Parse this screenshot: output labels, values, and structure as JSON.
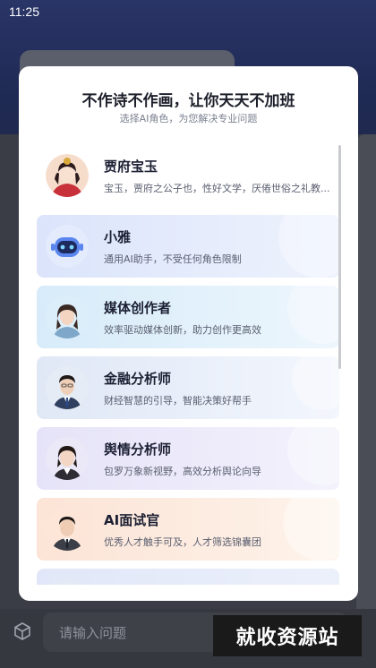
{
  "status_bar": {
    "time": "11:25"
  },
  "modal": {
    "title": "不作诗不作画，让你天天不加班",
    "subtitle": "选择AI角色，为您解决专业问题",
    "roles": [
      {
        "name": "贾府宝玉",
        "desc": "宝玉，贾府之公子也，性好文学，厌倦世俗之礼教..."
      },
      {
        "name": "小雅",
        "desc": "通用AI助手，不受任何角色限制"
      },
      {
        "name": "媒体创作者",
        "desc": "效率驱动媒体创新，助力创作更高效"
      },
      {
        "name": "金融分析师",
        "desc": "财经智慧的引导，智能决策好帮手"
      },
      {
        "name": "舆情分析师",
        "desc": "包罗万象新视野，高效分析舆论向导"
      },
      {
        "name": "AI面试官",
        "desc": "优秀人才触手可及，人才筛选锦囊团"
      }
    ]
  },
  "input": {
    "placeholder": "请输入问题"
  },
  "watermark": "就收资源站",
  "icons": {
    "cube": "cube-icon",
    "robot": "robot-icon"
  },
  "colors": {
    "accent": "#3f6ee8",
    "modal_bg": "#ffffff",
    "overlay": "#3a3d46"
  }
}
